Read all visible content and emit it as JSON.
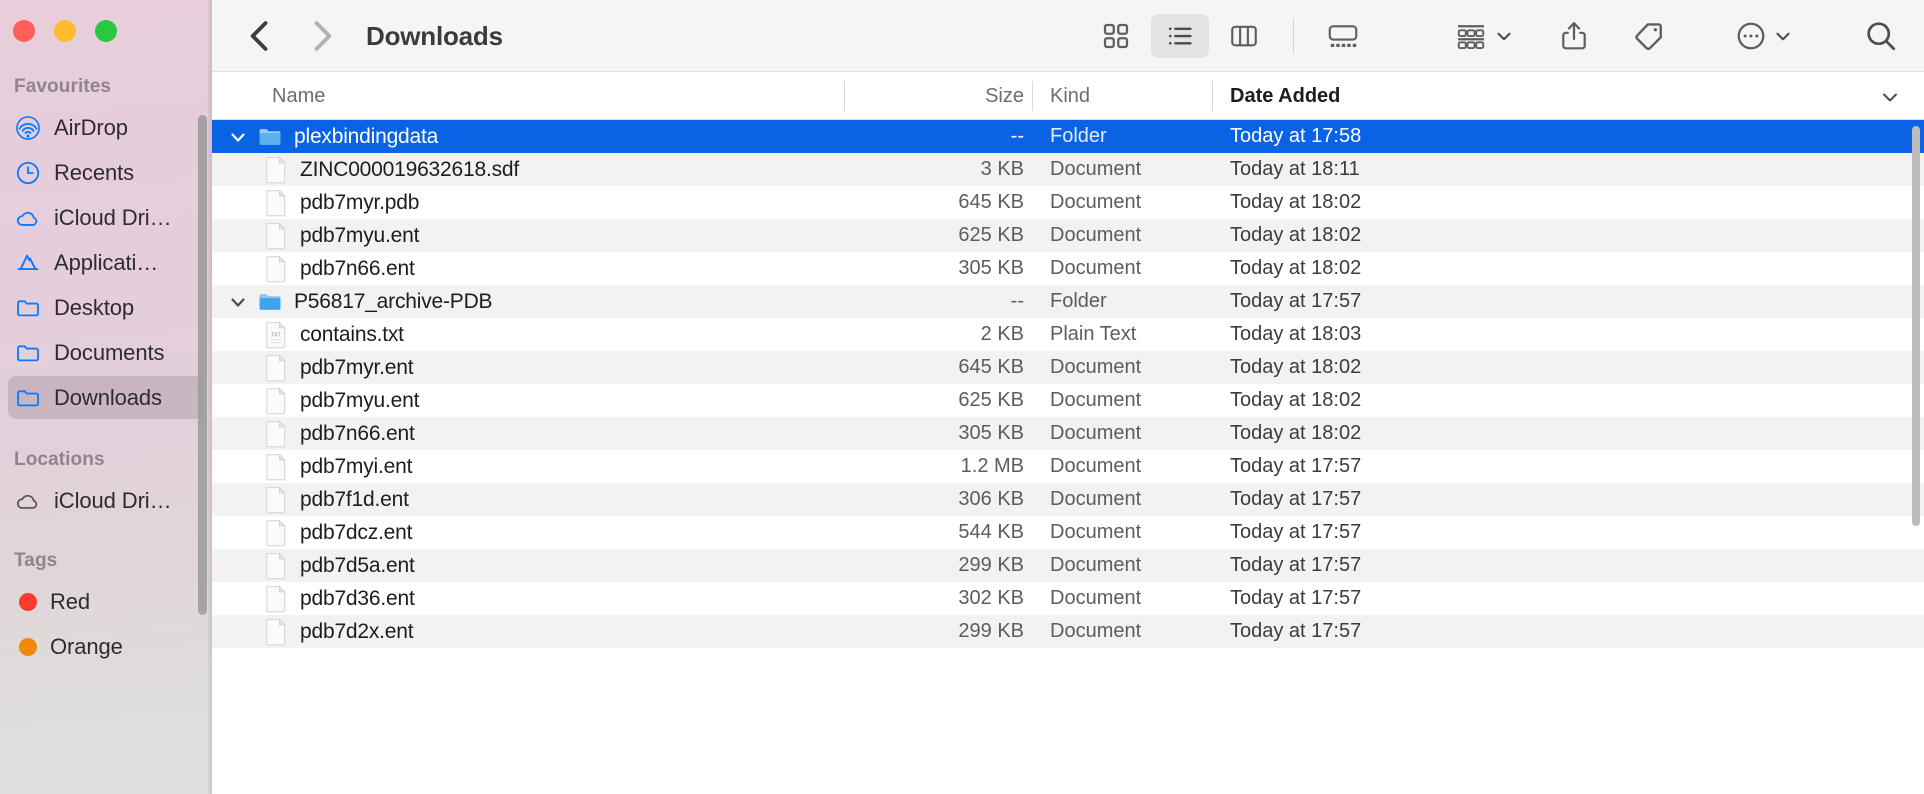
{
  "window": {
    "traffic_lights": [
      "close",
      "minimize",
      "maximize"
    ],
    "accent_color": "#0a63e5"
  },
  "sidebar": {
    "sections": [
      {
        "title": "Favourites",
        "items": [
          {
            "label": "AirDrop",
            "icon": "airdrop-icon",
            "selected": false
          },
          {
            "label": "Recents",
            "icon": "clock-icon",
            "selected": false
          },
          {
            "label": "iCloud Dri…",
            "icon": "cloud-icon",
            "selected": false
          },
          {
            "label": "Applicati…",
            "icon": "appstore-icon",
            "selected": false
          },
          {
            "label": "Desktop",
            "icon": "folder-icon",
            "selected": false
          },
          {
            "label": "Documents",
            "icon": "folder-icon",
            "selected": false
          },
          {
            "label": "Downloads",
            "icon": "folder-icon",
            "selected": true
          }
        ]
      },
      {
        "title": "Locations",
        "items": [
          {
            "label": "iCloud Dri…",
            "icon": "cloud-gray-icon",
            "selected": false
          }
        ]
      },
      {
        "title": "Tags",
        "items": [
          {
            "label": "Red",
            "icon": "tag-dot-icon",
            "color": "#fc3b2d",
            "selected": false
          },
          {
            "label": "Orange",
            "icon": "tag-dot-icon",
            "color": "#ef8a08",
            "selected": false
          }
        ]
      }
    ]
  },
  "toolbar": {
    "back_label": "Back",
    "forward_label": "Forward",
    "title": "Downloads",
    "view_modes": [
      {
        "name": "icon-view",
        "label": "as Icons",
        "active": false
      },
      {
        "name": "list-view",
        "label": "as List",
        "active": true
      },
      {
        "name": "column-view",
        "label": "as Columns",
        "active": false
      },
      {
        "name": "gallery-view",
        "label": "as Gallery",
        "active": false
      }
    ],
    "group_label": "Group",
    "share_label": "Share",
    "tag_label": "Tags",
    "more_label": "More",
    "search_label": "Search"
  },
  "columns": {
    "name": "Name",
    "size": "Size",
    "kind": "Kind",
    "date_added": "Date Added",
    "sort_column": "Date Added",
    "sort_direction": "descending"
  },
  "files": [
    {
      "name": "plexbindingdata",
      "size": "--",
      "kind": "Folder",
      "date": "Today at 17:58",
      "type": "folder",
      "level": 0,
      "expanded": true,
      "selected": true
    },
    {
      "name": "ZINC000019632618.sdf",
      "size": "3 KB",
      "kind": "Document",
      "date": "Today at 18:11",
      "type": "document",
      "level": 1,
      "expanded": false,
      "selected": false
    },
    {
      "name": "pdb7myr.pdb",
      "size": "645 KB",
      "kind": "Document",
      "date": "Today at 18:02",
      "type": "document",
      "level": 1,
      "expanded": false,
      "selected": false
    },
    {
      "name": "pdb7myu.ent",
      "size": "625 KB",
      "kind": "Document",
      "date": "Today at 18:02",
      "type": "document",
      "level": 1,
      "expanded": false,
      "selected": false
    },
    {
      "name": "pdb7n66.ent",
      "size": "305 KB",
      "kind": "Document",
      "date": "Today at 18:02",
      "type": "document",
      "level": 1,
      "expanded": false,
      "selected": false
    },
    {
      "name": "P56817_archive-PDB",
      "size": "--",
      "kind": "Folder",
      "date": "Today at 17:57",
      "type": "folder",
      "level": 0,
      "expanded": true,
      "selected": false
    },
    {
      "name": "contains.txt",
      "size": "2 KB",
      "kind": "Plain Text",
      "date": "Today at 18:03",
      "type": "text",
      "level": 1,
      "expanded": false,
      "selected": false
    },
    {
      "name": "pdb7myr.ent",
      "size": "645 KB",
      "kind": "Document",
      "date": "Today at 18:02",
      "type": "document",
      "level": 1,
      "expanded": false,
      "selected": false
    },
    {
      "name": "pdb7myu.ent",
      "size": "625 KB",
      "kind": "Document",
      "date": "Today at 18:02",
      "type": "document",
      "level": 1,
      "expanded": false,
      "selected": false
    },
    {
      "name": "pdb7n66.ent",
      "size": "305 KB",
      "kind": "Document",
      "date": "Today at 18:02",
      "type": "document",
      "level": 1,
      "expanded": false,
      "selected": false
    },
    {
      "name": "pdb7myi.ent",
      "size": "1.2 MB",
      "kind": "Document",
      "date": "Today at 17:57",
      "type": "document",
      "level": 1,
      "expanded": false,
      "selected": false
    },
    {
      "name": "pdb7f1d.ent",
      "size": "306 KB",
      "kind": "Document",
      "date": "Today at 17:57",
      "type": "document",
      "level": 1,
      "expanded": false,
      "selected": false
    },
    {
      "name": "pdb7dcz.ent",
      "size": "544 KB",
      "kind": "Document",
      "date": "Today at 17:57",
      "type": "document",
      "level": 1,
      "expanded": false,
      "selected": false
    },
    {
      "name": "pdb7d5a.ent",
      "size": "299 KB",
      "kind": "Document",
      "date": "Today at 17:57",
      "type": "document",
      "level": 1,
      "expanded": false,
      "selected": false
    },
    {
      "name": "pdb7d36.ent",
      "size": "302 KB",
      "kind": "Document",
      "date": "Today at 17:57",
      "type": "document",
      "level": 1,
      "expanded": false,
      "selected": false
    },
    {
      "name": "pdb7d2x.ent",
      "size": "299 KB",
      "kind": "Document",
      "date": "Today at 17:57",
      "type": "document",
      "level": 1,
      "expanded": false,
      "selected": false
    }
  ]
}
